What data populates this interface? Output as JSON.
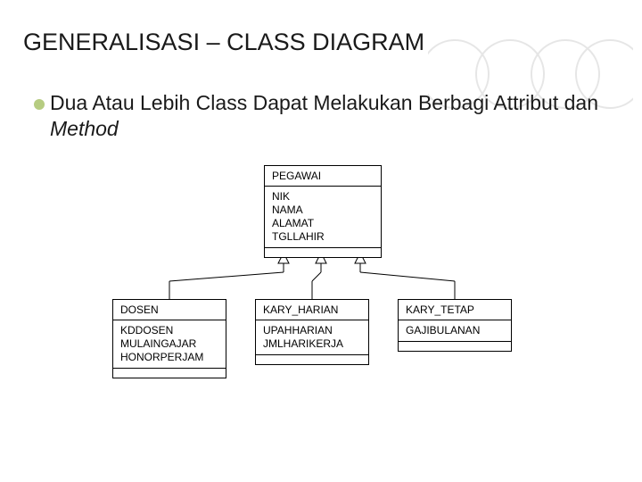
{
  "title": "GENERALISASI – CLASS DIAGRAM",
  "body_prefix": "Dua Atau Lebih Class Dapat Melakukan Berbagi Attribut dan ",
  "body_italic": "Method",
  "parent": {
    "name": "PEGAWAI",
    "attrs": [
      "NIK",
      "NAMA",
      "ALAMAT",
      "TGLLAHIR"
    ]
  },
  "children": [
    {
      "name": "DOSEN",
      "attrs": [
        "KDDOSEN",
        "MULAINGAJAR",
        "HONORPERJAM"
      ]
    },
    {
      "name": "KARY_HARIAN",
      "attrs": [
        "UPAHHARIAN",
        "JMLHARIKERJA"
      ]
    },
    {
      "name": "KARY_TETAP",
      "attrs": [
        "GAJIBULANAN"
      ]
    }
  ]
}
